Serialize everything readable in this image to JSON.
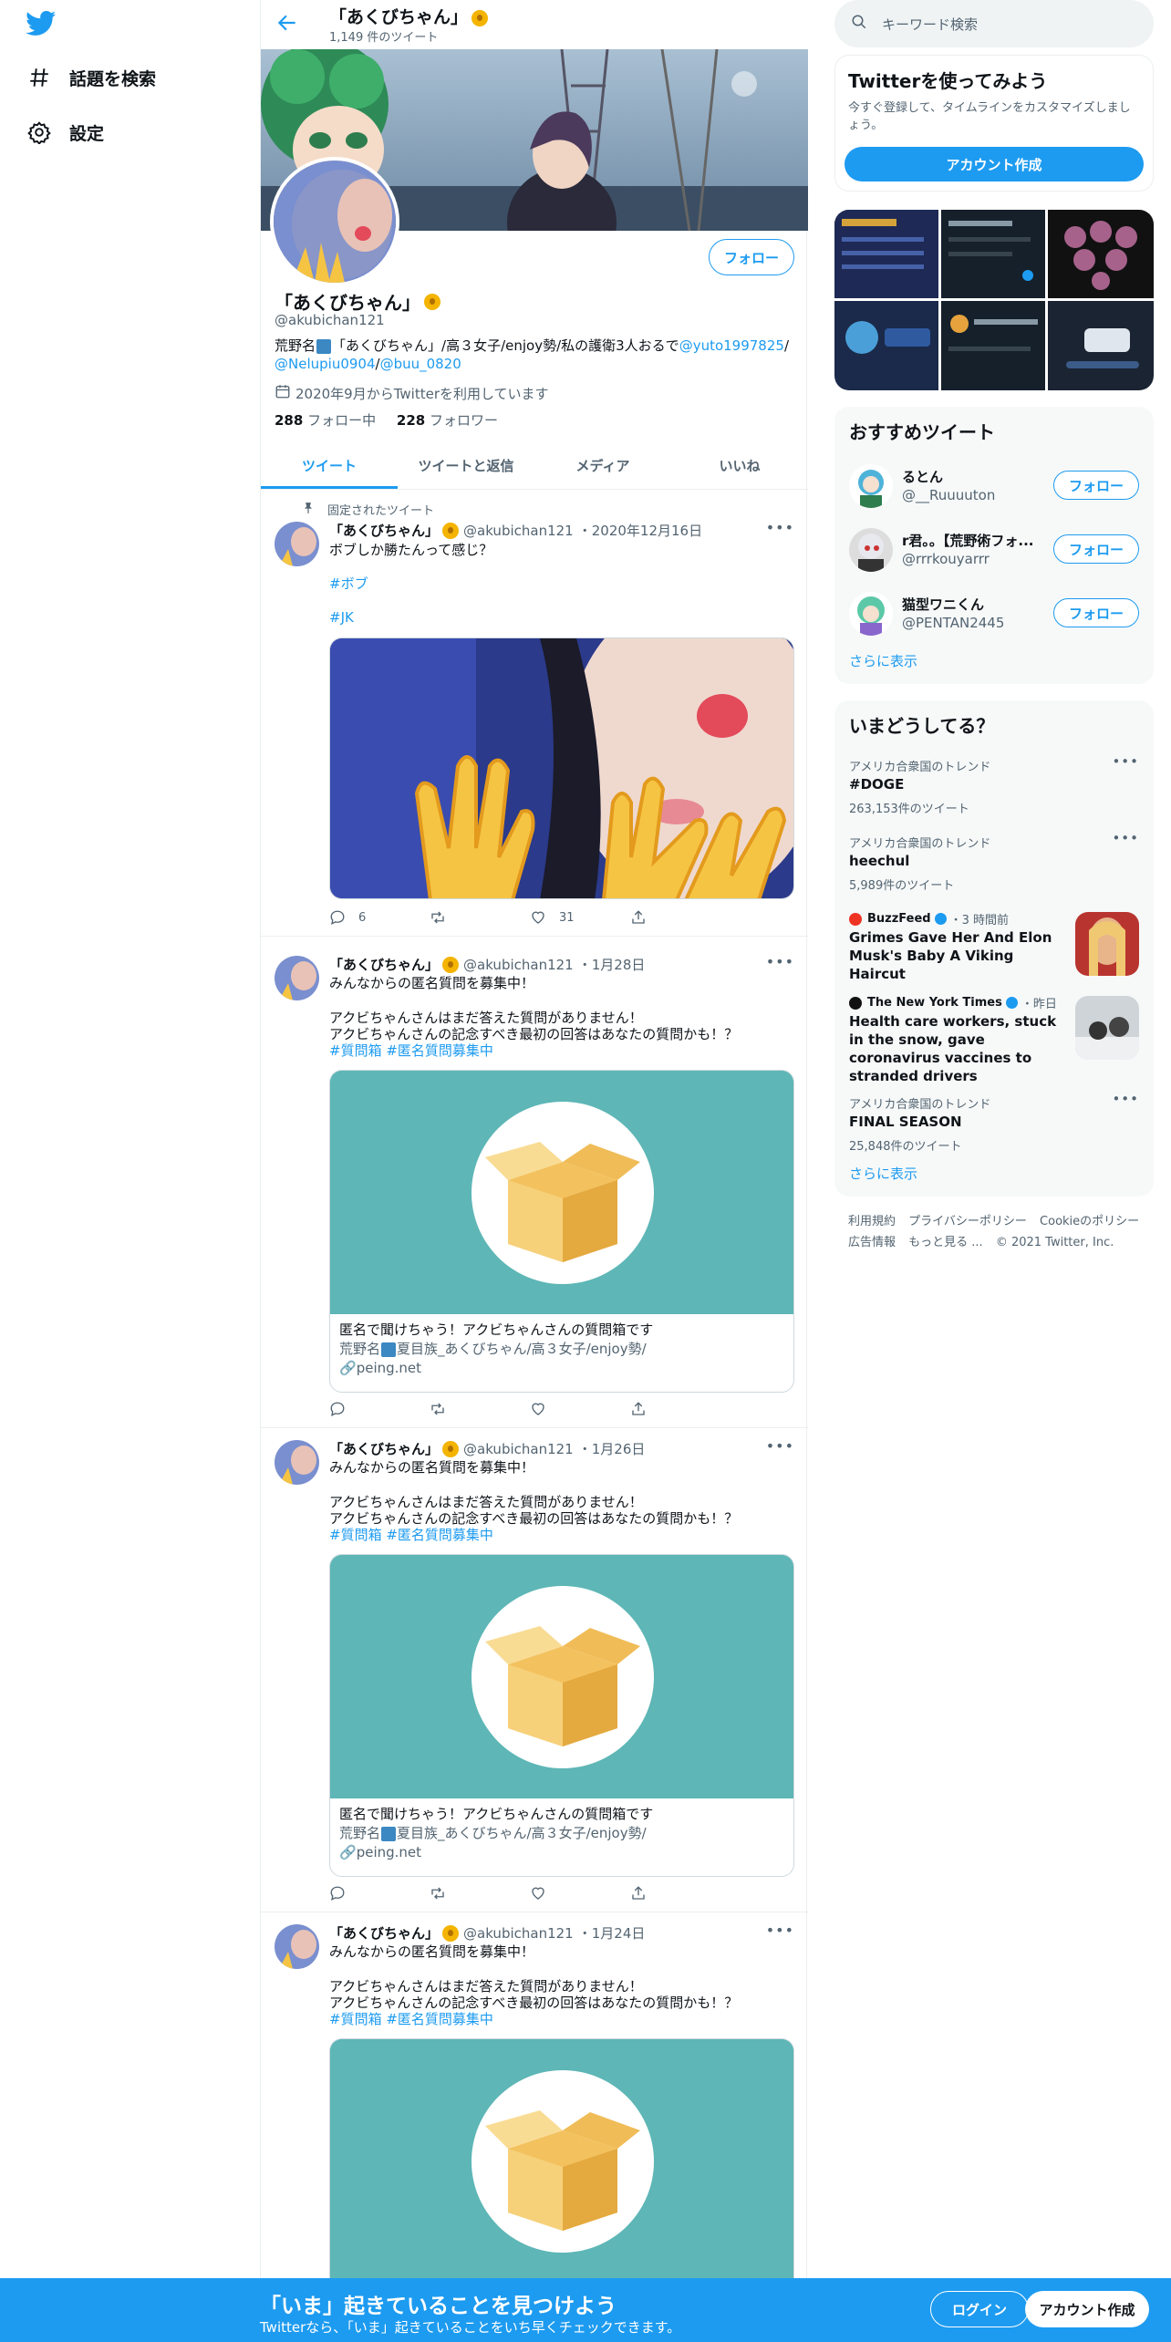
{
  "profile": {
    "name": "「あくびちゃん」",
    "tweet_count": "1,149 件のツイート",
    "handle": "@akubichan121",
    "bio_prefix": "荒野名",
    "bio_text": "「あくびちゃん」/高３女子/enjoy勢/私の護衛3人おるで",
    "bio_mention1": "@yuto1997825",
    "bio_slash": "/",
    "bio_mention2": "@Nelupiu0904",
    "bio_mention3": "@buu_0820",
    "joined": "2020年9月からTwitterを利用しています",
    "following_count": "288",
    "following_label": "フォロー中",
    "followers_count": "228",
    "followers_label": "フォロワー",
    "follow_button": "フォロー"
  },
  "nav": {
    "explore": "話題を検索",
    "settings": "設定"
  },
  "tabs": [
    "ツイート",
    "ツイートと返信",
    "メディア",
    "いいね"
  ],
  "pinned_label": "固定されたツイート",
  "tweets": [
    {
      "name": "「あくびちゃん」",
      "handle": "@akubichan121",
      "date": "2020年12月16日",
      "line1": "ボブしか勝たんって感じ？",
      "tag1": "#ボブ",
      "tag2": "#JK",
      "replies": "6",
      "likes": "31"
    },
    {
      "name": "「あくびちゃん」",
      "handle": "@akubichan121",
      "date": "1月28日",
      "line1": "みんなからの匿名質問を募集中！",
      "line2": "アクビちゃんさんはまだ答えた質問がありません！",
      "line3": "アクビちゃんさんの記念すべき最初の回答はあなたの質問かも！？",
      "tags": "#質問箱 #匿名質問募集中",
      "card_title": "匿名で聞けちゃう！アクビちゃんさんの質問箱です",
      "card_desc_pre": "荒野名",
      "card_desc": "夏目族_あくびちゃん/高３女子/enjoy勢/",
      "card_domain": "peing.net"
    },
    {
      "name": "「あくびちゃん」",
      "handle": "@akubichan121",
      "date": "1月26日",
      "line1": "みんなからの匿名質問を募集中！",
      "line2": "アクビちゃんさんはまだ答えた質問がありません！",
      "line3": "アクビちゃんさんの記念すべき最初の回答はあなたの質問かも！？",
      "tags": "#質問箱 #匿名質問募集中",
      "card_title": "匿名で聞けちゃう！アクビちゃんさんの質問箱です",
      "card_desc_pre": "荒野名",
      "card_desc": "夏目族_あくびちゃん/高３女子/enjoy勢/",
      "card_domain": "peing.net"
    },
    {
      "name": "「あくびちゃん」",
      "handle": "@akubichan121",
      "date": "1月24日",
      "line1": "みんなからの匿名質問を募集中！",
      "line2": "アクビちゃんさんはまだ答えた質問がありません！",
      "line3": "アクビちゃんさんの記念すべき最初の回答はあなたの質問かも！？",
      "tags": "#質問箱 #匿名質問募集中"
    }
  ],
  "right": {
    "search_placeholder": "キーワード検索",
    "signup_title": "Twitterを使ってみよう",
    "signup_desc": "今すぐ登録して、タイムラインをカスタマイズしましょう。",
    "signup_button": "アカウント作成",
    "suggest_title": "おすすめツイート",
    "suggestions": [
      {
        "name": "るとん",
        "handle": "@__Ruuuuton"
      },
      {
        "name": "r君。。【荒野術フォ...",
        "handle": "@rrrkouyarrr"
      },
      {
        "name": "猫型ワニくん",
        "handle": "@PENTAN2445"
      }
    ],
    "show_more": "さらに表示",
    "trends_title": "いまどうしてる？",
    "trends": [
      {
        "context": "アメリカ合衆国のトレンド",
        "title": "#DOGE",
        "count": "263,153件のツイート"
      },
      {
        "context": "アメリカ合衆国のトレンド",
        "title": "heechul",
        "count": "5,989件のツイート"
      },
      {
        "source": "BuzzFeed",
        "time": "・3 時間前",
        "title": "Grimes Gave Her And Elon Musk's Baby A Viking Haircut"
      },
      {
        "source": "The New York Times",
        "time": "・昨日",
        "title": "Health care workers, stuck in the snow, gave coronavirus vaccines to stranded drivers"
      },
      {
        "context": "アメリカ合衆国のトレンド",
        "title": "FINAL SEASON",
        "count": "25,848件のツイート"
      }
    ],
    "footer": [
      "利用規約",
      "プライバシーポリシー",
      "Cookieのポリシー",
      "広告情報",
      "もっと見る ...",
      "© 2021 Twitter, Inc."
    ]
  },
  "bottom": {
    "title": "「いま」起きていることを見つけよう",
    "subtitle": "Twitterなら、「いま」起きていることをいち早くチェックできます。",
    "login": "ログイン",
    "signup": "アカウント作成"
  },
  "colors": {
    "accent": "#1d9bf0",
    "card_bg": "#5eb6b6"
  }
}
